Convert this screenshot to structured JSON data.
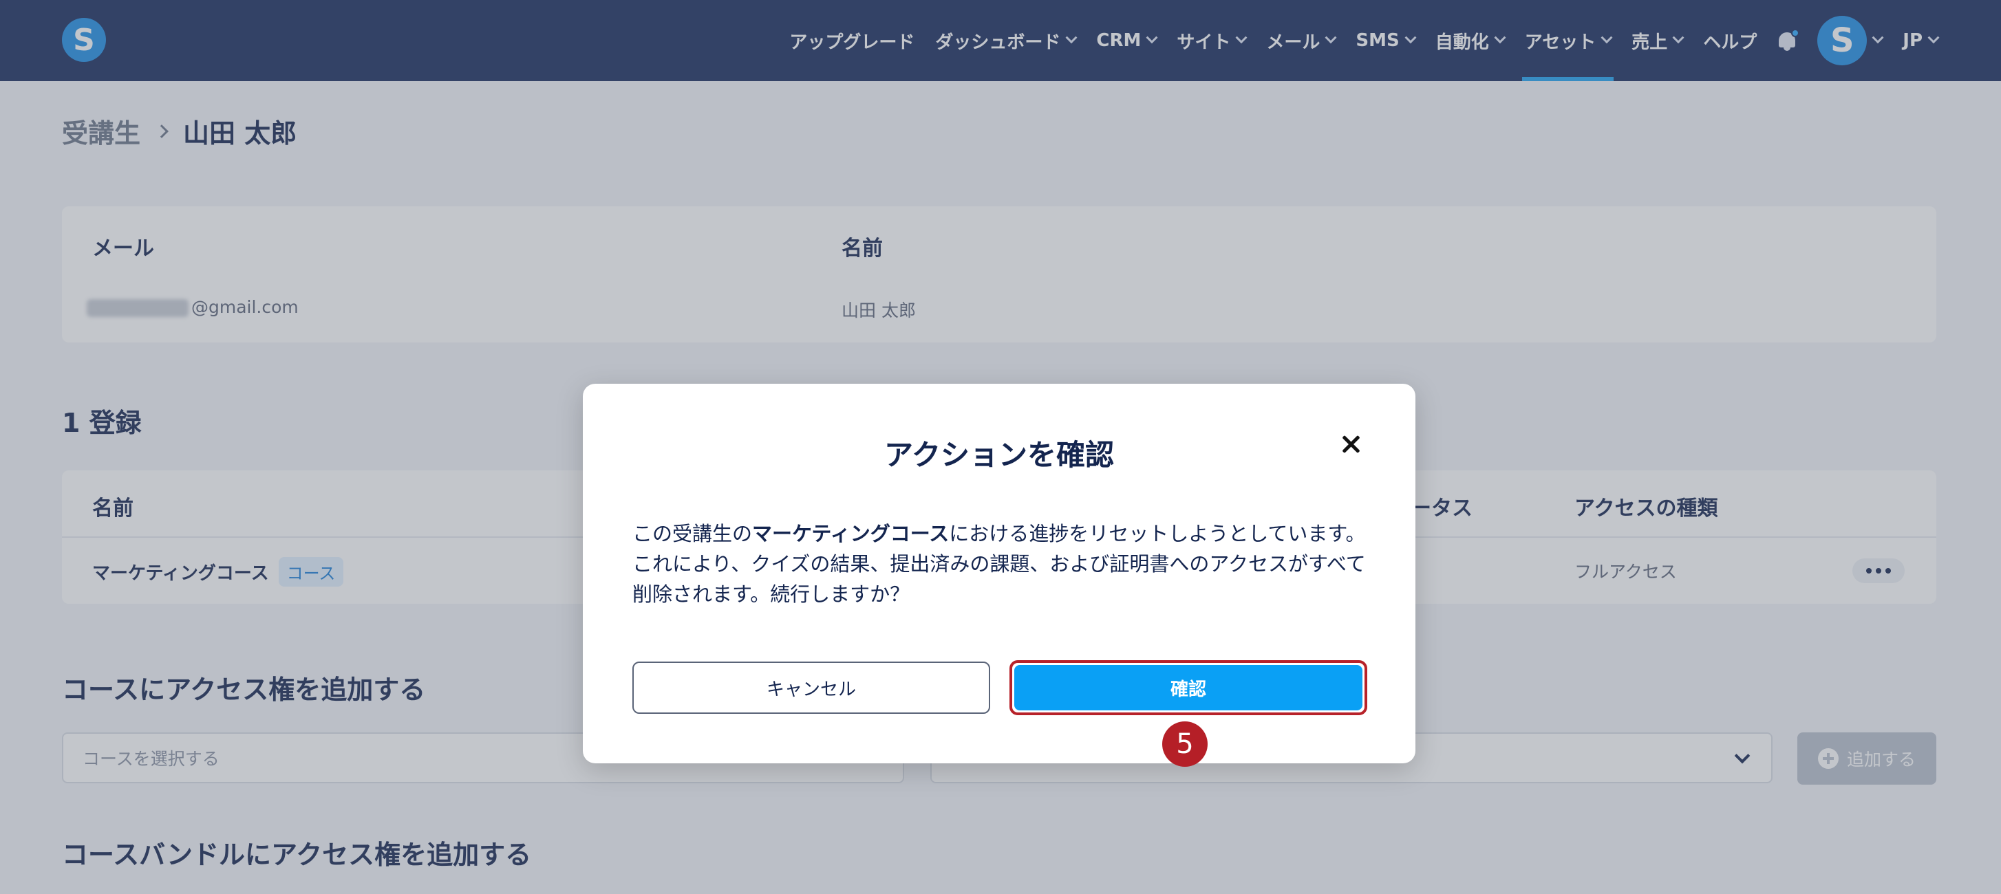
{
  "nav": {
    "logo": "S",
    "items": [
      {
        "label": "アップグレード",
        "chevron": false
      },
      {
        "label": "ダッシュボード",
        "chevron": true
      },
      {
        "label": "CRM",
        "chevron": true
      },
      {
        "label": "サイト",
        "chevron": true
      },
      {
        "label": "メール",
        "chevron": true
      },
      {
        "label": "SMS",
        "chevron": true
      },
      {
        "label": "自動化",
        "chevron": true
      },
      {
        "label": "アセット",
        "chevron": true,
        "active": true
      },
      {
        "label": "売上",
        "chevron": true
      },
      {
        "label": "ヘルプ",
        "chevron": false
      }
    ],
    "avatar": "S",
    "language": "JP"
  },
  "breadcrumb": {
    "parent": "受講生",
    "current": "山田 太郎"
  },
  "student": {
    "email_label": "メール",
    "email_value": "@gmail.com",
    "name_label": "名前",
    "name_value": "山田 太郎"
  },
  "enrollments": {
    "title": "1 登録",
    "col_name": "名前",
    "col_status": "ータス",
    "col_access": "アクセスの種類",
    "row": {
      "name": "マーケティングコース",
      "tag": "コース",
      "access": "フルアクセス"
    }
  },
  "add_course": {
    "title": "コースにアクセス権を追加する",
    "select_placeholder": "コースを選択する",
    "add_button": "追加する"
  },
  "add_bundle": {
    "title": "コースバンドルにアクセス権を追加する"
  },
  "modal": {
    "title": "アクションを確認",
    "body_prefix": "この受講生の",
    "body_bold": "マーケティングコース",
    "body_suffix": "における進捗をリセットしようとしています。これにより、クイズの結果、提出済みの課題、および証明書へのアクセスがすべて削除されます。続行しますか？",
    "cancel": "キャンセル",
    "confirm": "確認"
  },
  "step_badge": "5",
  "colors": {
    "nav_bg": "#182a5c",
    "accent": "#0aa0f5",
    "highlight": "#b7222a",
    "brand": "#1f8fe6"
  }
}
